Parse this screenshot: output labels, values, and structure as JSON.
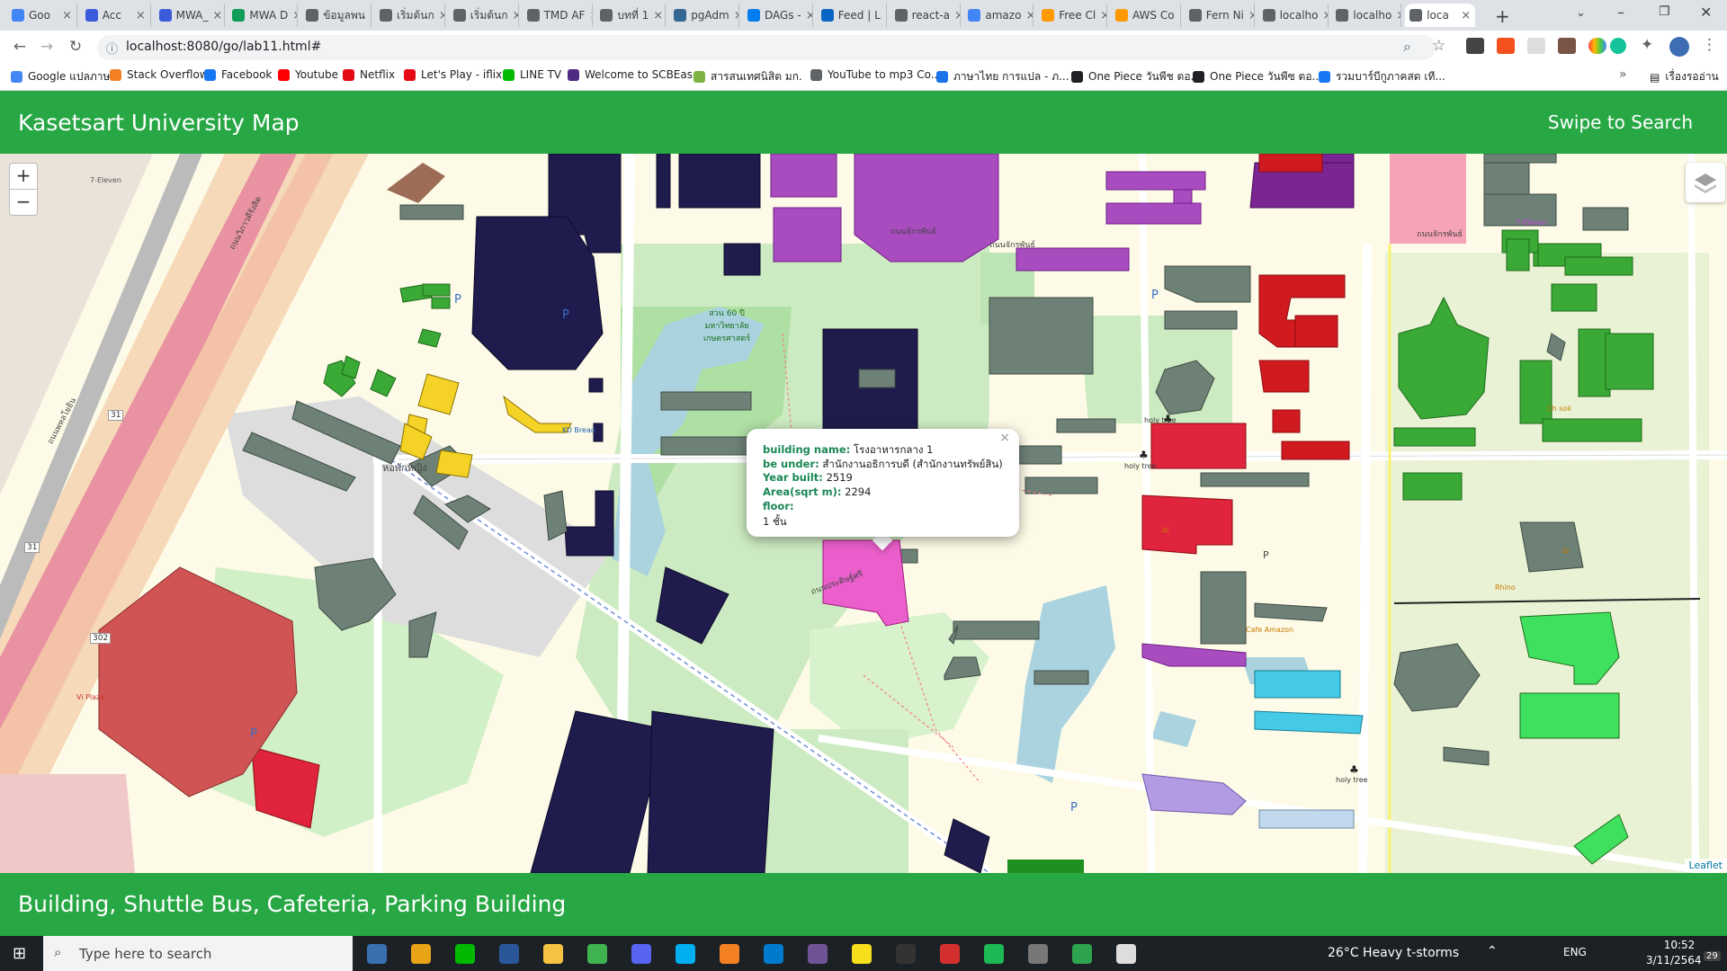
{
  "browser": {
    "tabs": [
      {
        "label": "Goo",
        "color": "#4285f4"
      },
      {
        "label": "Acc",
        "color": "#3b5bdb"
      },
      {
        "label": "MWA_",
        "color": "#3b5bdb"
      },
      {
        "label": "MWA D",
        "color": "#0f9d58"
      },
      {
        "label": "ข้อมูลพน",
        "color": "#5f6368"
      },
      {
        "label": "เริ่มต้นก",
        "color": "#5f6368"
      },
      {
        "label": "เริ่มต้นก",
        "color": "#5f6368"
      },
      {
        "label": "TMD AF",
        "color": "#5f6368"
      },
      {
        "label": "บทที่ 1",
        "color": "#5f6368"
      },
      {
        "label": "pgAdm",
        "color": "#336791"
      },
      {
        "label": "DAGs -",
        "color": "#017cee"
      },
      {
        "label": "Feed | L",
        "color": "#0a66c2"
      },
      {
        "label": "react-a",
        "color": "#5f6368"
      },
      {
        "label": "amazo",
        "color": "#4285f4"
      },
      {
        "label": "Free Cl",
        "color": "#ff9900"
      },
      {
        "label": "AWS Co",
        "color": "#ff9900"
      },
      {
        "label": "Fern Ni",
        "color": "#5f6368"
      },
      {
        "label": "localho",
        "color": "#5f6368"
      },
      {
        "label": "localho",
        "color": "#5f6368"
      },
      {
        "label": "loca",
        "color": "#5f6368"
      }
    ],
    "url": "localhost:8080/go/lab11.html#",
    "bookmarks": [
      {
        "label": "Google แปลภาษา",
        "color": "#4285f4"
      },
      {
        "label": "Stack Overflow",
        "color": "#f48024"
      },
      {
        "label": "Facebook",
        "color": "#1877f2"
      },
      {
        "label": "Youtube",
        "color": "#ff0000"
      },
      {
        "label": "Netflix",
        "color": "#e50914"
      },
      {
        "label": "Let's Play - iflix",
        "color": "#e50914"
      },
      {
        "label": "LINE TV",
        "color": "#00b900"
      },
      {
        "label": "Welcome to SCBEas...",
        "color": "#4e2a84"
      },
      {
        "label": "สารสนเทศนิสิต มก.",
        "color": "#7cb342"
      },
      {
        "label": "YouTube to mp3 Co...",
        "color": "#5f6368"
      },
      {
        "label": "ภาษาไทย การแปล - ภ...",
        "color": "#1a73e8"
      },
      {
        "label": "One Piece วันพีช ตอ...",
        "color": "#202124"
      },
      {
        "label": "One Piece วันพีซ ตอ...",
        "color": "#202124"
      },
      {
        "label": "รวมบาร์บีกูภาคสด เที...",
        "color": "#1877f2"
      }
    ],
    "other_bookmarks": "เรื่องรออ่าน"
  },
  "app": {
    "title": "Kasetsart University Map",
    "swipe_label": "Swipe to Search",
    "footer": "Building, Shuttle Bus, Cafeteria, Parking Building"
  },
  "map": {
    "zoom_in": "+",
    "zoom_out": "−",
    "attribution": "Leaflet",
    "labels": [
      {
        "text": "ถนนจักรพันธ์",
        "cls": "road"
      },
      {
        "text": "ถนนจักรพันธ์",
        "cls": "road"
      },
      {
        "text": "ถนนจักรพันธ์",
        "cls": "road"
      },
      {
        "text": "ถนนวิภาวดีรังสิต",
        "cls": "road"
      },
      {
        "text": "ถนนพหลโยธิน",
        "cls": "road"
      },
      {
        "text": "ถนนประดิษฐ์ศรี",
        "cls": "road"
      },
      {
        "text": "สวน 60 ปี มหาวิทยาลัยเกษตรศาสตร์",
        "cls": "park"
      },
      {
        "text": "หอพักหญิง",
        "cls": "place"
      },
      {
        "text": "holy tree",
        "cls": "place"
      },
      {
        "text": "holy tree",
        "cls": "place"
      },
      {
        "text": "holy tree",
        "cls": "place"
      },
      {
        "text": "7-Eleven",
        "cls": "shop"
      },
      {
        "text": "7-Eleven",
        "cls": "shop"
      },
      {
        "text": "Cafe Amazon",
        "cls": "shop"
      },
      {
        "text": "KU Bread",
        "cls": "shop"
      },
      {
        "text": "Rhino",
        "cls": "shop"
      },
      {
        "text": "Vi Plaza",
        "cls": "shop"
      },
      {
        "text": "302",
        "cls": "shield"
      },
      {
        "text": "31",
        "cls": "shield"
      },
      {
        "text": "31",
        "cls": "shield"
      },
      {
        "text": "Ch soil",
        "cls": "shop"
      }
    ]
  },
  "popup": {
    "close": "×",
    "rows": [
      {
        "key": "building name:",
        "value": "โรงอาหารกลาง 1"
      },
      {
        "key": "be under:",
        "value": "สำนักงานอธิการบดี (สำนักงานทรัพย์สิน)"
      },
      {
        "key": "Year built:",
        "value": "2519"
      },
      {
        "key": "Area(sqrt m):",
        "value": "2294"
      },
      {
        "key": "floor:",
        "value": ""
      }
    ],
    "floor_value": "1 ชั้น"
  },
  "taskbar": {
    "search_placeholder": "Type here to search",
    "weather": "26°C  Heavy t-storms",
    "lang": "ENG",
    "time": "10:52",
    "date": "3/11/2564",
    "notifications": "29"
  }
}
